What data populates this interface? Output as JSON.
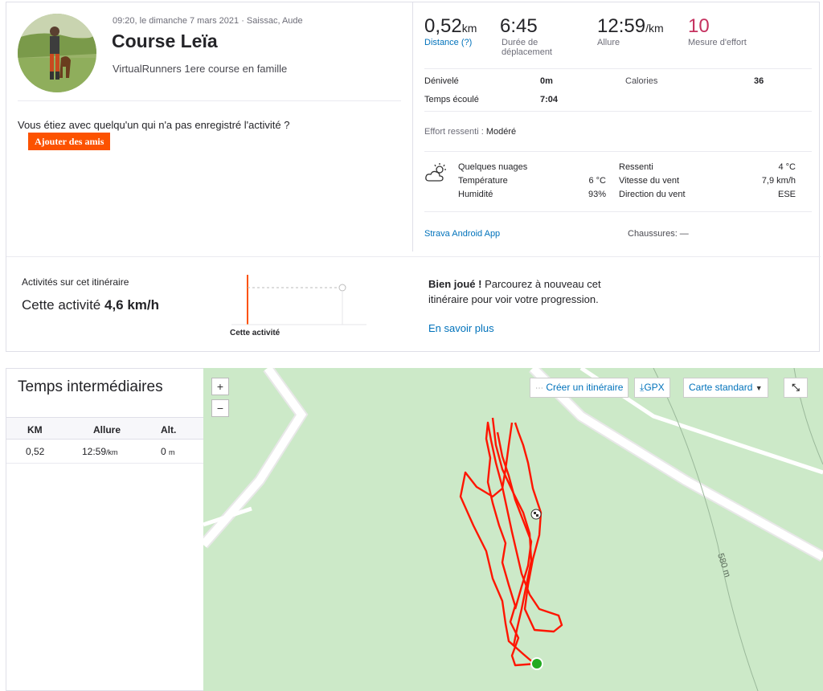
{
  "activity": {
    "date_location": "09:20, le dimanche 7 mars 2021 · Saissac, Aude",
    "title": "Course Leïa",
    "subtitle": "VirtualRunners 1ere course en famille",
    "friends_question": "Vous étiez avec quelqu'un qui n'a pas enregistré l'activité ?",
    "add_friends_label": "Ajouter des amis"
  },
  "stats": {
    "distance_value": "0,52",
    "distance_unit": "km",
    "distance_label": "Distance (?)",
    "moving_time_value": "6:45",
    "moving_time_label": "Durée de déplacement",
    "pace_value": "12:59",
    "pace_unit": "/km",
    "pace_label": "Allure",
    "effort_value": "10",
    "effort_label": "Mesure d'effort"
  },
  "details": {
    "elevation_label": "Dénivelé",
    "elevation_value": "0m",
    "calories_label": "Calories",
    "calories_value": "36",
    "elapsed_label": "Temps écoulé",
    "elapsed_value": "7:04",
    "perceived_label": "Effort ressenti : ",
    "perceived_value": "Modéré"
  },
  "weather": {
    "icon": "partly-cloudy-icon",
    "condition": "Quelques nuages",
    "temp_label": "Température",
    "temp_value": "6 °C",
    "humidity_label": "Humidité",
    "humidity_value": "93%",
    "feels_label": "Ressenti",
    "feels_value": "4 °C",
    "wind_speed_label": "Vitesse du vent",
    "wind_speed_value": "7,9 km/h",
    "wind_dir_label": "Direction du vent",
    "wind_dir_value": "ESE"
  },
  "device": {
    "app_label": "Strava Android App",
    "shoes_label": "Chaussures: —"
  },
  "segment": {
    "label": "Activités sur cet itinéraire",
    "this_activity_prefix": "Cette activité ",
    "this_activity_speed": "4,6 km/h",
    "chart_label": "Cette activité",
    "message_bold": "Bien joué !",
    "message_rest": " Parcourez à nouveau cet itinéraire pour voir votre progression.",
    "learn_more": "En savoir plus"
  },
  "splits": {
    "title": "Temps intermédiaires",
    "headers": [
      "KM",
      "Allure",
      "Alt."
    ],
    "rows": [
      {
        "km": "0,52",
        "pace": "12:59",
        "pace_unit": "/km",
        "alt": "0",
        "alt_unit": "m"
      }
    ]
  },
  "map": {
    "zoom_in": "+",
    "zoom_out": "−",
    "create_route": "Créer un itinéraire",
    "gpx": "GPX",
    "map_type": "Carte standard",
    "contour_label": "580 m",
    "colors": {
      "grass": "#cce9c8",
      "road": "#ffffff",
      "track": "#ff1500",
      "start": "#22aa22"
    }
  },
  "colors": {
    "accent": "#fc5200",
    "link": "#0072bb",
    "effort": "#c5315f"
  }
}
